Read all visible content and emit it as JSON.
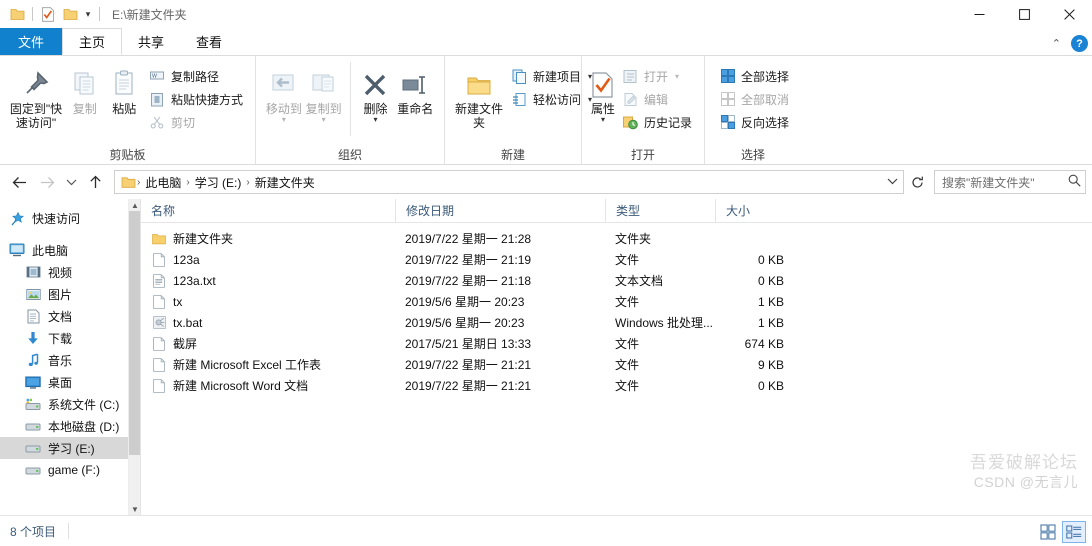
{
  "titlebar": {
    "path_text": "E:\\新建文件夹",
    "qat": [
      {
        "name": "folder-icon",
        "label": "属性"
      },
      {
        "name": "properties-check-icon",
        "label": "属性"
      },
      {
        "name": "new-folder-icon",
        "label": "新建文件夹"
      }
    ],
    "minimize_label": "最小化",
    "maximize_label": "最大化",
    "close_label": "关闭"
  },
  "tabs": [
    {
      "label": "文件",
      "state": "file-menu"
    },
    {
      "label": "主页",
      "state": "active"
    },
    {
      "label": "共享",
      "state": "normal"
    },
    {
      "label": "查看",
      "state": "normal"
    }
  ],
  "ribbon": {
    "help_label": "?",
    "collapse_label": "^",
    "groups": [
      {
        "name": "clipboard",
        "label": "剪贴板",
        "big": [
          {
            "name": "pin-to-quick-access",
            "label": "固定到\"快速访问\"",
            "icon": "pin-icon",
            "disabled": false,
            "dropdown": false
          },
          {
            "name": "copy",
            "label": "复制",
            "icon": "copy-icon",
            "disabled": true,
            "dropdown": false
          },
          {
            "name": "paste",
            "label": "粘贴",
            "icon": "paste-icon",
            "disabled": false,
            "dropdown": false
          }
        ],
        "small": [
          {
            "name": "copy-path",
            "label": "复制路径",
            "icon": "copy-path-icon",
            "disabled": false,
            "dropdown": false
          },
          {
            "name": "paste-shortcut",
            "label": "粘贴快捷方式",
            "icon": "paste-shortcut-icon",
            "disabled": false,
            "dropdown": false
          },
          {
            "name": "cut",
            "label": "剪切",
            "icon": "scissors-icon",
            "disabled": true,
            "dropdown": false
          }
        ]
      },
      {
        "name": "organize",
        "label": "组织",
        "big": [
          {
            "name": "move-to",
            "label": "移动到",
            "icon": "move-to-icon",
            "disabled": true,
            "dropdown": true
          },
          {
            "name": "copy-to",
            "label": "复制到",
            "icon": "copy-to-icon",
            "disabled": true,
            "dropdown": true
          },
          {
            "name": "delete",
            "label": "删除",
            "icon": "delete-x-icon",
            "disabled": false,
            "dropdown": true
          },
          {
            "name": "rename",
            "label": "重命名",
            "icon": "rename-icon",
            "disabled": false,
            "dropdown": false
          }
        ],
        "small": []
      },
      {
        "name": "new",
        "label": "新建",
        "big": [
          {
            "name": "new-folder",
            "label": "新建文件夹",
            "icon": "new-folder-icon",
            "disabled": false,
            "dropdown": false
          }
        ],
        "small": [
          {
            "name": "new-item",
            "label": "新建项目",
            "icon": "new-item-icon",
            "disabled": false,
            "dropdown": true
          },
          {
            "name": "easy-access",
            "label": "轻松访问",
            "icon": "easy-access-icon",
            "disabled": false,
            "dropdown": true
          }
        ]
      },
      {
        "name": "open",
        "label": "打开",
        "big": [
          {
            "name": "properties",
            "label": "属性",
            "icon": "properties-check-icon",
            "disabled": false,
            "dropdown": true
          }
        ],
        "small": [
          {
            "name": "open",
            "label": "打开",
            "icon": "open-icon",
            "disabled": true,
            "dropdown": true
          },
          {
            "name": "edit",
            "label": "编辑",
            "icon": "edit-icon",
            "disabled": true,
            "dropdown": false
          },
          {
            "name": "history",
            "label": "历史记录",
            "icon": "history-icon",
            "disabled": false,
            "dropdown": false
          }
        ]
      },
      {
        "name": "select",
        "label": "选择",
        "big": [],
        "small": [
          {
            "name": "select-all",
            "label": "全部选择",
            "icon": "select-all-icon",
            "disabled": false,
            "dropdown": false
          },
          {
            "name": "select-none",
            "label": "全部取消",
            "icon": "select-none-icon",
            "disabled": true,
            "dropdown": false
          },
          {
            "name": "invert-selection",
            "label": "反向选择",
            "icon": "invert-selection-icon",
            "disabled": false,
            "dropdown": false
          }
        ]
      }
    ]
  },
  "addressbar": {
    "back_label": "←",
    "forward_label": "→",
    "recent_label": "⌄",
    "up_label": "↑",
    "breadcrumbs": [
      "此电脑",
      "学习 (E:)",
      "新建文件夹"
    ],
    "dropdown_label": "⌄",
    "refresh_label": "↻"
  },
  "search": {
    "placeholder": "搜索\"新建文件夹\"",
    "icon": "search-icon"
  },
  "sidebar": {
    "items": [
      {
        "label": "快速访问",
        "icon": "star-pin-icon",
        "indent": false,
        "selected": false
      },
      {
        "label": "此电脑",
        "icon": "computer-icon",
        "indent": false,
        "selected": false
      },
      {
        "label": "视频",
        "icon": "videos-icon",
        "indent": true,
        "selected": false
      },
      {
        "label": "图片",
        "icon": "pictures-icon",
        "indent": true,
        "selected": false
      },
      {
        "label": "文档",
        "icon": "documents-icon",
        "indent": true,
        "selected": false
      },
      {
        "label": "下载",
        "icon": "downloads-icon",
        "indent": true,
        "selected": false
      },
      {
        "label": "音乐",
        "icon": "music-icon",
        "indent": true,
        "selected": false
      },
      {
        "label": "桌面",
        "icon": "desktop-icon",
        "indent": true,
        "selected": false
      },
      {
        "label": "系统文件 (C:)",
        "icon": "system-drive-icon",
        "indent": true,
        "selected": false
      },
      {
        "label": "本地磁盘 (D:)",
        "icon": "drive-icon",
        "indent": true,
        "selected": false
      },
      {
        "label": "学习 (E:)",
        "icon": "drive-icon",
        "indent": true,
        "selected": true
      },
      {
        "label": "game (F:)",
        "icon": "drive-icon",
        "indent": true,
        "selected": false
      }
    ]
  },
  "filelist": {
    "columns": [
      {
        "label": "名称",
        "key": "name"
      },
      {
        "label": "修改日期",
        "key": "date"
      },
      {
        "label": "类型",
        "key": "type"
      },
      {
        "label": "大小",
        "key": "size"
      }
    ],
    "rows": [
      {
        "name": "新建文件夹",
        "date": "2019/7/22 星期一 21:28",
        "type": "文件夹",
        "size": "",
        "icon": "folder-icon"
      },
      {
        "name": "123a",
        "date": "2019/7/22 星期一 21:19",
        "type": "文件",
        "size": "0 KB",
        "icon": "blank-file-icon"
      },
      {
        "name": "123a.txt",
        "date": "2019/7/22 星期一 21:18",
        "type": "文本文档",
        "size": "0 KB",
        "icon": "text-file-icon"
      },
      {
        "name": "tx",
        "date": "2019/5/6 星期一 20:23",
        "type": "文件",
        "size": "1 KB",
        "icon": "blank-file-icon"
      },
      {
        "name": "tx.bat",
        "date": "2019/5/6 星期一 20:23",
        "type": "Windows 批处理...",
        "size": "1 KB",
        "icon": "bat-file-icon"
      },
      {
        "name": "截屏",
        "date": "2017/5/21 星期日 13:33",
        "type": "文件",
        "size": "674 KB",
        "icon": "blank-file-icon"
      },
      {
        "name": "新建 Microsoft Excel 工作表",
        "date": "2019/7/22 星期一 21:21",
        "type": "文件",
        "size": "9 KB",
        "icon": "blank-file-icon"
      },
      {
        "name": "新建 Microsoft Word 文档",
        "date": "2019/7/22 星期一 21:21",
        "type": "文件",
        "size": "0 KB",
        "icon": "blank-file-icon"
      }
    ]
  },
  "statusbar": {
    "item_count": "8 个项目",
    "views": [
      {
        "name": "large-icons-view",
        "selected": false
      },
      {
        "name": "details-view",
        "selected": true
      }
    ]
  },
  "watermark": {
    "line1": "吾爱破解论坛",
    "line2": "CSDN @无言儿"
  },
  "colors": {
    "accent": "#1281cd",
    "folder": "#f7cf6b",
    "selection": "#d8d8d8",
    "header_text": "#3b5a78"
  }
}
